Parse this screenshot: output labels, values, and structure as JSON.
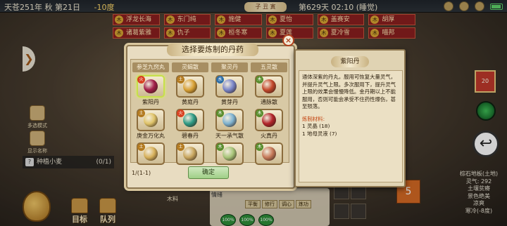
{
  "status_bar": {
    "date": "天苍251年 秋 第21日",
    "temperature": "-10度",
    "season_banner": "子 丑 寅",
    "day_time": "第629天 02:10 (睡觉)"
  },
  "characters": [
    [
      "浮龙长海",
      "东门纯",
      "施健",
      "夏怡",
      "盖赛安",
      "胡厚"
    ],
    [
      "诸葛紫雅",
      "仇子",
      "桓冬寒",
      "夏莲",
      "夏冷雪",
      "喵邦"
    ]
  ],
  "side": {
    "btn1": "多选模式",
    "btn2": "显示名称",
    "task_label": "种植小麦",
    "task_count": "(0/1)"
  },
  "bottom": {
    "target": "目标",
    "team": "队列",
    "wood": "木料",
    "info": "情绪",
    "tabs": [
      "平衡",
      "修行",
      "调心",
      "炼功"
    ],
    "pcts": [
      "100%",
      "100%",
      "100%"
    ],
    "orange": "5"
  },
  "right_hud": {
    "red_badge": "20",
    "location": [
      "棕石地板(土地)",
      "灵气: 292",
      "土壤贫瘠",
      "景色绝美",
      "凉爽",
      "寒冷(-8度)"
    ]
  },
  "dialog": {
    "title": "选择要炼制的丹药",
    "categories": [
      "参芝九窍丸",
      "灵蝎散",
      "聚灵丹",
      "五灵散"
    ],
    "items": [
      {
        "name": "紫阳丹",
        "element": "火",
        "elem_class": "fire",
        "color": "#a3204a",
        "selected": true
      },
      {
        "name": "黄庭丹",
        "element": "土",
        "elem_class": "earth",
        "color": "#d9a236",
        "selected": false
      },
      {
        "name": "黄芽丹",
        "element": "水",
        "elem_class": "water",
        "color": "#7a86c9",
        "selected": false
      },
      {
        "name": "通脉散",
        "element": "木",
        "elem_class": "wood",
        "color": "#c4492c",
        "selected": false
      },
      {
        "name": "庚金万化丸",
        "element": "土",
        "elem_class": "earth",
        "color": "#e0c46a",
        "selected": false
      },
      {
        "name": "碧春丹",
        "element": "火",
        "elem_class": "fire",
        "color": "#2f9c86",
        "selected": false
      },
      {
        "name": "天一承气散",
        "element": "木",
        "elem_class": "wood",
        "color": "#7fb3d1",
        "selected": false
      },
      {
        "name": "火真丹",
        "element": "木",
        "elem_class": "wood",
        "color": "#b3262b",
        "selected": false
      },
      {
        "name": "",
        "element": "土",
        "elem_class": "earth",
        "color": "#d8b25c",
        "selected": false
      },
      {
        "name": "",
        "element": "土",
        "elem_class": "earth",
        "color": "#caa860",
        "selected": false
      },
      {
        "name": "",
        "element": "木",
        "elem_class": "wood",
        "color": "#a9c67a",
        "selected": false
      },
      {
        "name": "",
        "element": "木",
        "elem_class": "wood",
        "color": "#c77a5a",
        "selected": false
      }
    ],
    "page": "1/(1-1)",
    "confirm": "确定"
  },
  "detail": {
    "title": "紫阳丹",
    "description": "通体深紫的丹丸，服用可恢复大量灵气，并提升灵气上限。多次服用下，提升灵气上限的效果会慢慢降低。金丹期以上不能服用，否则可能会承受不住药性爆伤，甚至殒落。",
    "materials_label": "炼制材料:",
    "materials": [
      "1 灵晶 (18)",
      "1 地母灵液 (7)"
    ]
  }
}
